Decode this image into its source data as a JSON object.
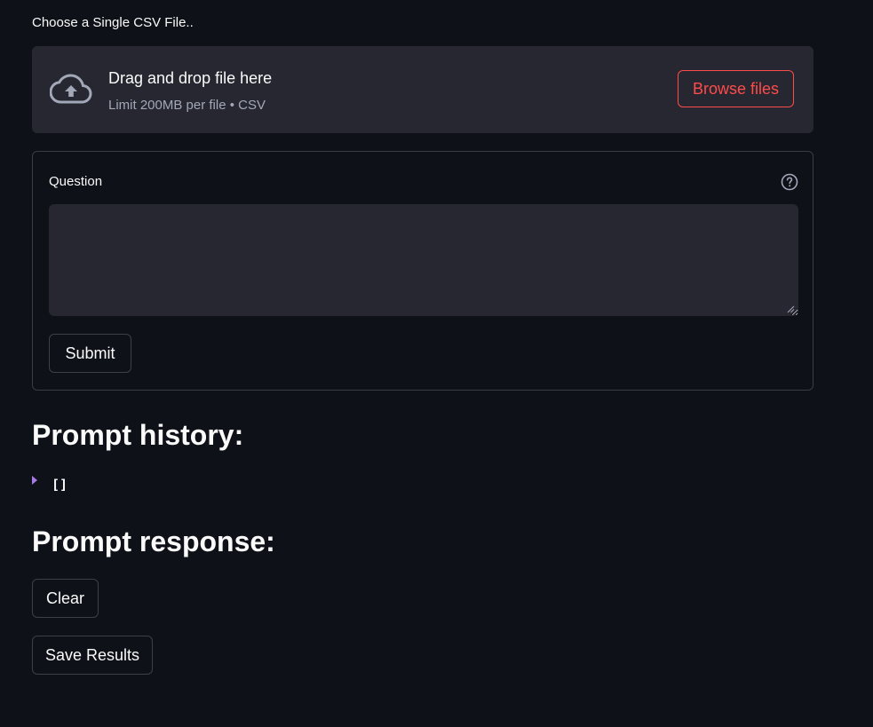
{
  "uploader": {
    "label": "Choose a Single CSV File..",
    "drop_title": "Drag and drop file here",
    "drop_limit": "Limit 200MB per file • CSV",
    "browse_label": "Browse files",
    "icon": "cloud-upload-icon"
  },
  "form": {
    "question_label": "Question",
    "question_value": "",
    "help_icon": "help-circle-icon",
    "submit_label": "Submit"
  },
  "history": {
    "heading": "Prompt history:",
    "expander_icon": "triangle-right-icon",
    "value": "[]"
  },
  "response": {
    "heading": "Prompt response:",
    "clear_label": "Clear",
    "save_label": "Save Results"
  },
  "colors": {
    "background": "#0e1117",
    "panel": "#262730",
    "accent": "#ff4b4b",
    "expander_accent": "#a77be6",
    "muted_text": "#a3a8b8"
  }
}
